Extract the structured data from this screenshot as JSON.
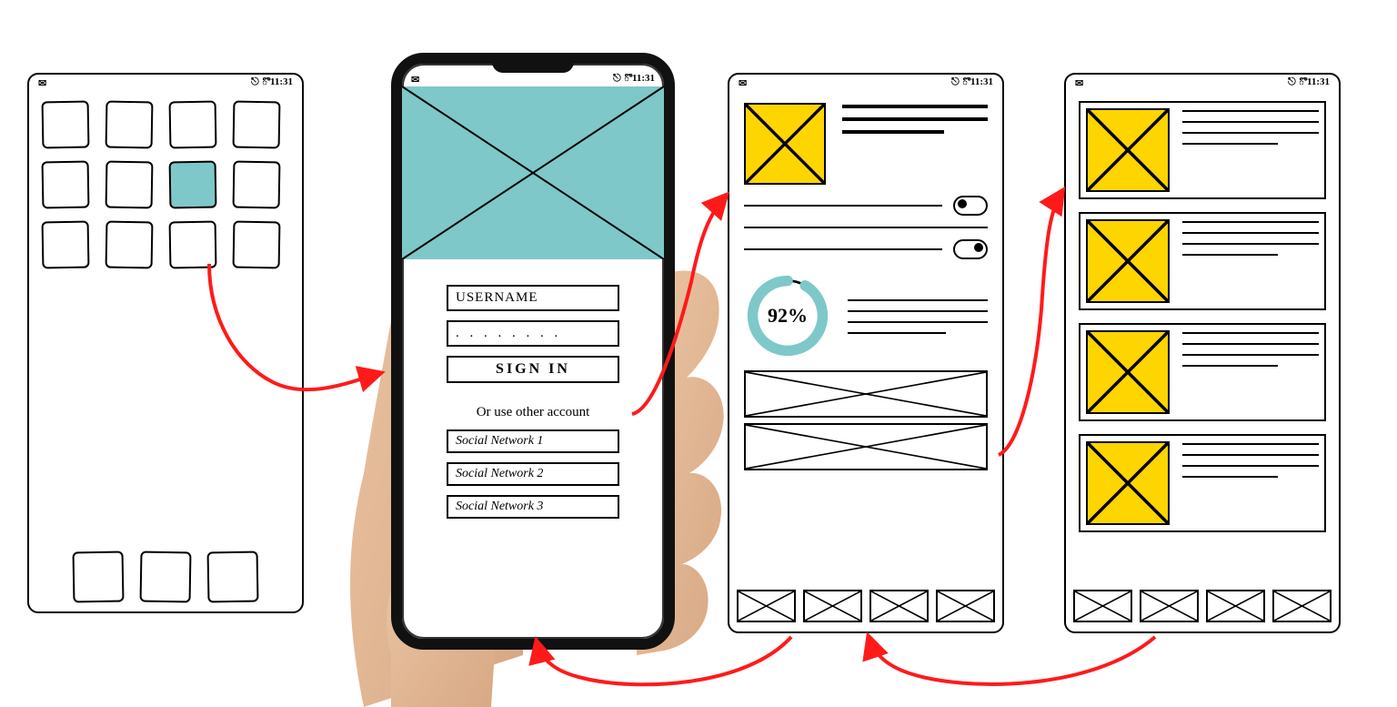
{
  "statusbar": {
    "time": "11:31",
    "wifi_icon": "wifi-icon",
    "battery_icon": "battery-icon",
    "mail_icon": "mail-icon"
  },
  "screen1": {
    "selected_index": 6,
    "icon_count": 12,
    "dock_count": 3
  },
  "login": {
    "username_label": "USERNAME",
    "password_mask": ". . . . . . . .",
    "signin_label": "SIGN IN",
    "divider_text": "Or use other account",
    "social": [
      "Social Network 1",
      "Social Network 2",
      "Social Network 3"
    ]
  },
  "dashboard": {
    "progress_value": "92%",
    "toggles": [
      "off",
      "on"
    ]
  },
  "list": {
    "item_count": 4
  },
  "colors": {
    "teal": "#7ec8c9",
    "yellow": "#ffd500",
    "arrow": "#ff1a1a"
  }
}
